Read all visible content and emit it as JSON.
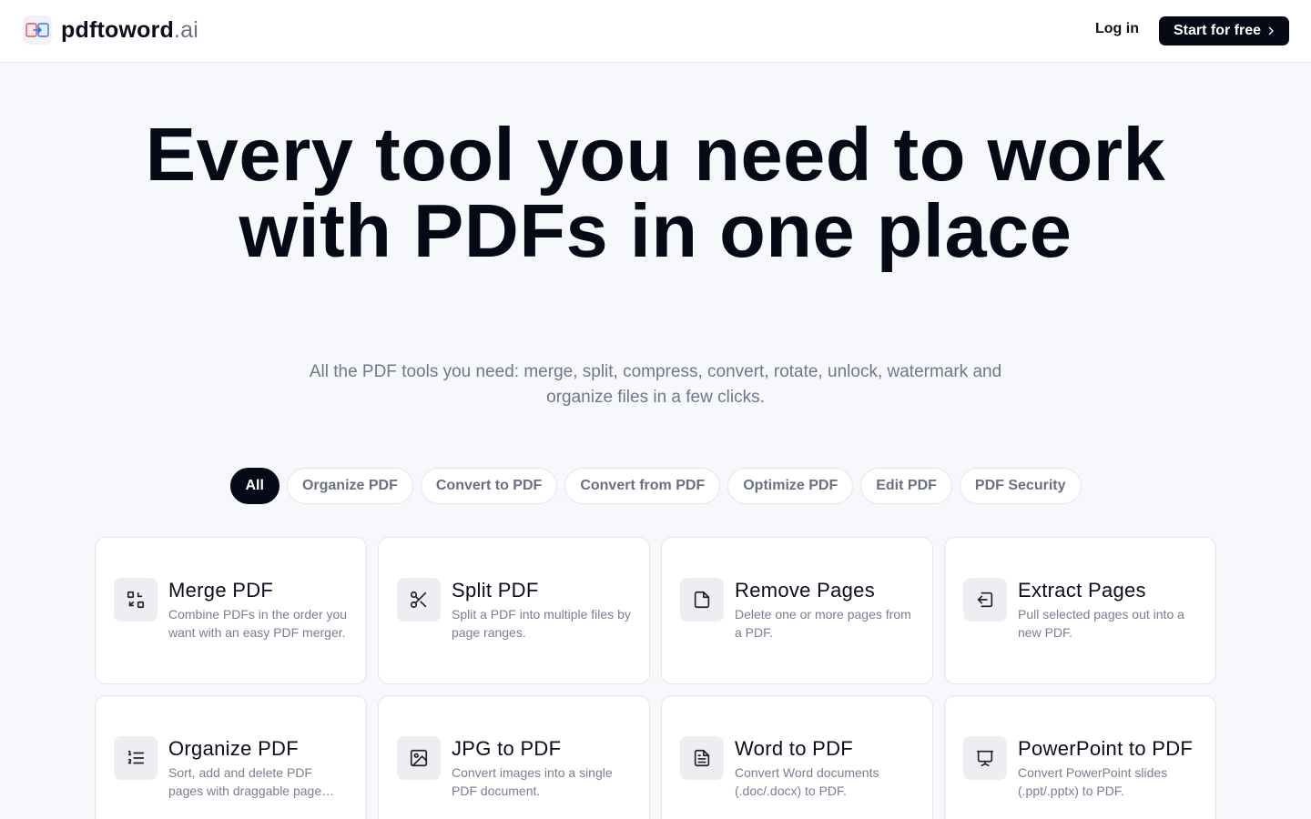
{
  "brand": {
    "name": "pdftoword",
    "suffix": ".ai"
  },
  "nav": {
    "login_label": "Log in",
    "cta_label": "Start for free",
    "cta_icon": "chevron-right-icon"
  },
  "hero": {
    "title": "Every tool you need to work with PDFs in one place",
    "subtitle": "All the PDF tools you need: merge, split, compress, convert, rotate, unlock, watermark and organize files in a few clicks."
  },
  "filters": [
    {
      "label": "All",
      "active": true
    },
    {
      "label": "Organize PDF",
      "active": false
    },
    {
      "label": "Convert to PDF",
      "active": false
    },
    {
      "label": "Convert from PDF",
      "active": false
    },
    {
      "label": "Optimize PDF",
      "active": false
    },
    {
      "label": "Edit PDF",
      "active": false
    },
    {
      "label": "PDF Security",
      "active": false
    }
  ],
  "tools": [
    {
      "title": "Merge PDF",
      "desc": "Combine PDFs in the order you want with an easy PDF merger.",
      "icon": "merge-icon"
    },
    {
      "title": "Split PDF",
      "desc": "Split a PDF into multiple files by page ranges.",
      "icon": "scissors-icon"
    },
    {
      "title": "Remove Pages",
      "desc": "Delete one or more pages from a PDF.",
      "icon": "file-icon"
    },
    {
      "title": "Extract Pages",
      "desc": "Pull selected pages out into a new PDF.",
      "icon": "extract-icon"
    },
    {
      "title": "Organize PDF",
      "desc": "Sort, add and delete PDF pages with draggable page thumbnails.",
      "icon": "list-ordered-icon"
    },
    {
      "title": "JPG to PDF",
      "desc": "Convert images into a single PDF document.",
      "icon": "image-icon"
    },
    {
      "title": "Word to PDF",
      "desc": "Convert Word documents (.doc/.docx) to PDF.",
      "icon": "document-text-icon"
    },
    {
      "title": "PowerPoint to PDF",
      "desc": "Convert PowerPoint slides (.ppt/.pptx) to PDF.",
      "icon": "presentation-icon"
    }
  ],
  "colors": {
    "primary": "#060916",
    "background": "#f7f8fc",
    "muted_text": "#72768a",
    "card_border": "#e3e5eb"
  }
}
